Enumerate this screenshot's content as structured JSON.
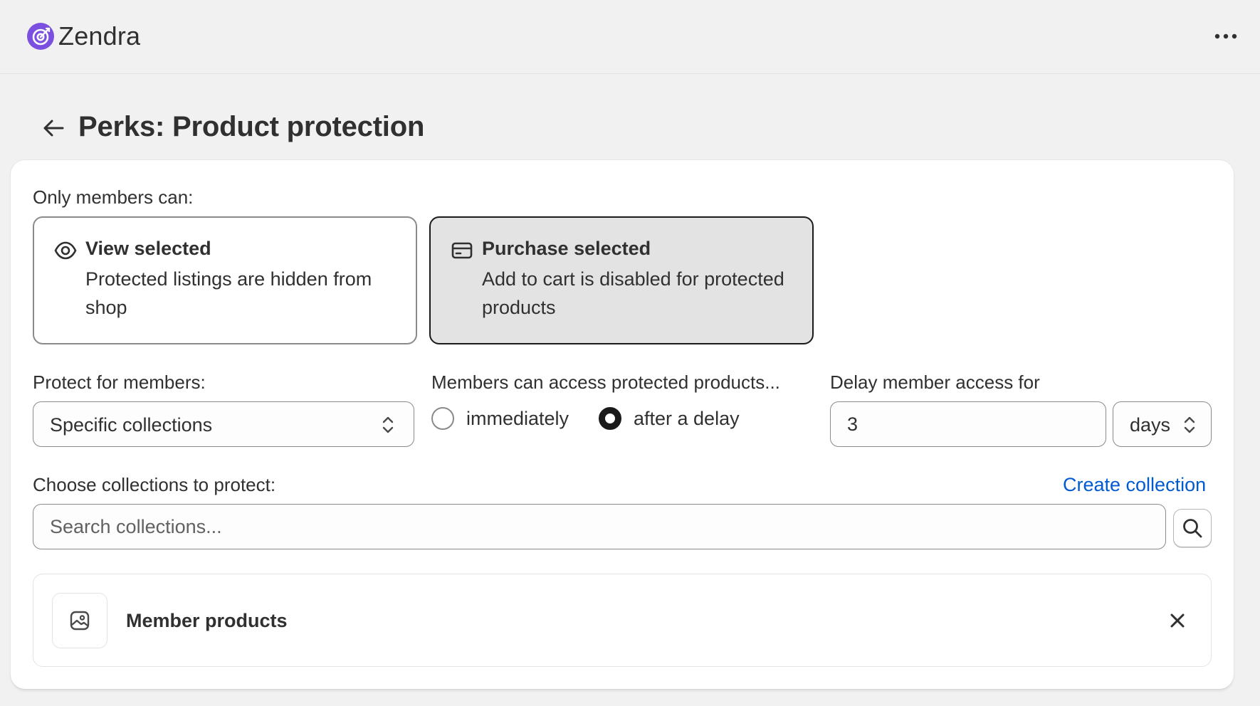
{
  "app": {
    "brand_name": "Zendra",
    "accent_color": "#7b4fe0"
  },
  "header": {
    "more_icon": "more-horizontal-icon",
    "back_icon": "arrow-left-icon",
    "page_title": "Perks: Product protection"
  },
  "restriction": {
    "label": "Only members can:",
    "options": [
      {
        "title": "View selected",
        "description": "Protected listings are hidden from shop",
        "icon": "eye-icon",
        "selected": false
      },
      {
        "title": "Purchase selected",
        "description": "Add to cart is disabled for protected products",
        "icon": "credit-card-icon",
        "selected": true
      }
    ]
  },
  "protect_for": {
    "label": "Protect for members:",
    "value": "Specific collections"
  },
  "access": {
    "label": "Members can access protected products...",
    "options": [
      {
        "label": "immediately",
        "checked": false
      },
      {
        "label": "after a delay",
        "checked": true
      }
    ]
  },
  "delay": {
    "label": "Delay member access for",
    "value": "3",
    "unit": "days"
  },
  "collections": {
    "label": "Choose collections to protect:",
    "create_link": "Create collection",
    "search_placeholder": "Search collections...",
    "search_icon": "search-icon",
    "items": [
      {
        "name": "Member products",
        "thumb_icon": "image-icon",
        "remove_icon": "close-icon"
      }
    ]
  }
}
